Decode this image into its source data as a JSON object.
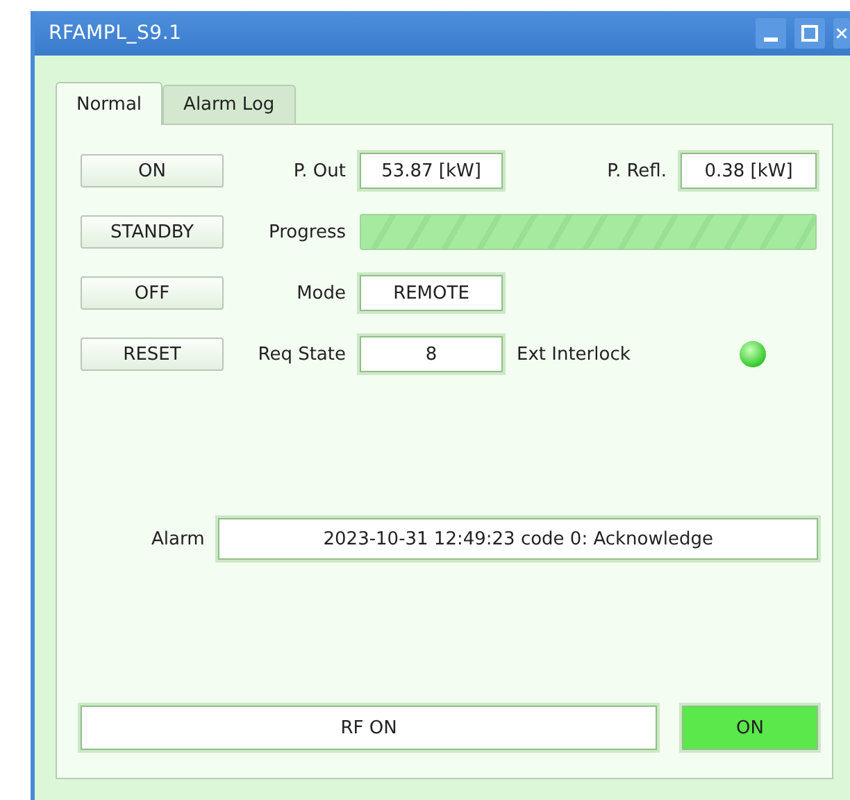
{
  "window": {
    "title": "RFAMPL_S9.1"
  },
  "tabs": [
    {
      "label": "Normal",
      "selected": true
    },
    {
      "label": "Alarm Log",
      "selected": false
    }
  ],
  "rows": [
    {
      "button": "ON",
      "label": "P. Out",
      "value": "53.87 [kW]",
      "kind": "pair",
      "label_2": "P. Refl.",
      "value_2": "0.38 [kW]"
    },
    {
      "button": "STANDBY",
      "label": "Progress",
      "kind": "progress",
      "level": 1
    },
    {
      "button": "OFF",
      "label": "Mode",
      "value": "REMOTE",
      "kind": "field"
    },
    {
      "button": "RESET",
      "label": "Req State",
      "value": "8",
      "kind": "led",
      "label_2": "Ext Interlock",
      "on": true
    }
  ],
  "alarm": {
    "label": "Alarm",
    "value": "2023-10-31 12:49:23 code 0: Acknowledge"
  },
  "status": {
    "text": "RF ON",
    "indicator": "ON",
    "on": true
  }
}
